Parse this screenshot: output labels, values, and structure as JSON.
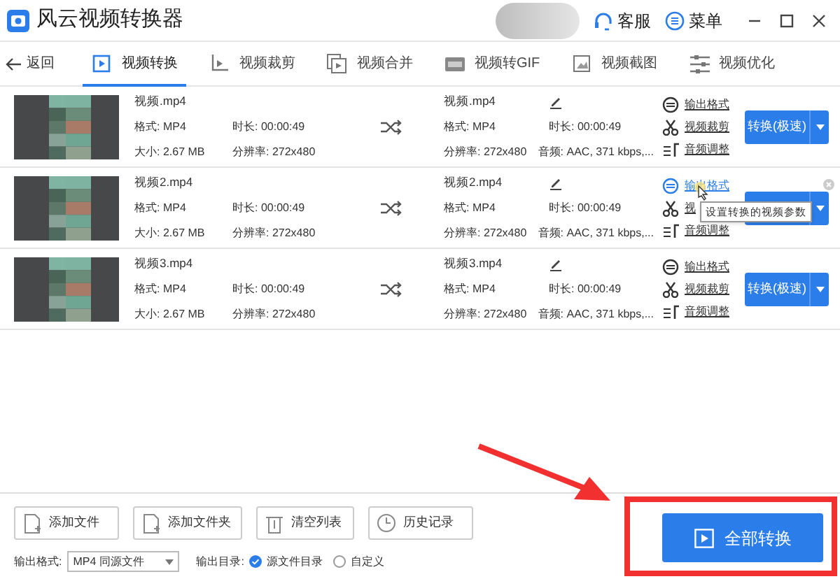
{
  "window": {
    "title": "风云视频转换器",
    "actions": [
      {
        "label": "客服",
        "kind": "support"
      },
      {
        "label": "菜单",
        "kind": "menu"
      }
    ]
  },
  "back": "返回",
  "tabs": [
    {
      "label": "视频转换",
      "kind": "convert",
      "selected": true
    },
    {
      "label": "视频裁剪",
      "kind": "crop",
      "selected": false
    },
    {
      "label": "视频合并",
      "kind": "merge",
      "selected": false
    },
    {
      "label": "视频转GIF",
      "kind": "gif",
      "selected": false
    },
    {
      "label": "视频截图",
      "kind": "shot",
      "selected": false
    },
    {
      "label": "视频优化",
      "kind": "tune",
      "selected": false
    }
  ],
  "files": [
    {
      "name": "视频.mp4",
      "format": "格式: MP4",
      "duration": "时长: 00:00:49",
      "size": "大小: 2.67 MB",
      "resolution": "分辨率: 272x480",
      "out_name": "视频.mp4",
      "out_format": "格式: MP4",
      "out_duration": "时长: 00:00:49",
      "out_resolution": "分辨率: 272x480",
      "audio": "音频: AAC, 371 kbps,...",
      "links": [
        {
          "label": "输出格式",
          "kind": "format",
          "hovered": false
        },
        {
          "label": "视频裁剪",
          "kind": "cut",
          "hovered": false
        },
        {
          "label": "音频调整",
          "kind": "audio",
          "hovered": false
        }
      ],
      "convert": "转换(极速)"
    },
    {
      "name": "视频2.mp4",
      "format": "格式: MP4",
      "duration": "时长: 00:00:49",
      "size": "大小: 2.67 MB",
      "resolution": "分辨率: 272x480",
      "out_name": "视频2.mp4",
      "out_format": "格式: MP4",
      "out_duration": "时长: 00:00:49",
      "out_resolution": "分辨率: 272x480",
      "audio": "音频: AAC, 371 kbps,...",
      "links": [
        {
          "label": "输出格式",
          "kind": "format",
          "hovered": true
        },
        {
          "label": "视",
          "kind": "cut",
          "hovered": false
        },
        {
          "label": "音频调整",
          "kind": "audio",
          "hovered": false
        }
      ],
      "tooltip": "设置转换的视频参数"
    },
    {
      "name": "视频3.mp4",
      "format": "格式: MP4",
      "duration": "时长: 00:00:49",
      "size": "大小: 2.67 MB",
      "resolution": "分辨率: 272x480",
      "out_name": "视频3.mp4",
      "out_format": "格式: MP4",
      "out_duration": "时长: 00:00:49",
      "out_resolution": "分辨率: 272x480",
      "audio": "音频: AAC, 371 kbps,...",
      "links": [
        {
          "label": "输出格式",
          "kind": "format",
          "hovered": false
        },
        {
          "label": "视频裁剪",
          "kind": "cut",
          "hovered": false
        },
        {
          "label": "音频调整",
          "kind": "audio",
          "hovered": false
        }
      ],
      "convert": "转换(极速)"
    }
  ],
  "toolbar": [
    {
      "label": "添加文件",
      "kind": "file"
    },
    {
      "label": "添加文件夹",
      "kind": "folder"
    },
    {
      "label": "清空列表",
      "kind": "trash"
    },
    {
      "label": "历史记录",
      "kind": "clock"
    }
  ],
  "output_format": {
    "label": "输出格式:",
    "value": "MP4 同源文件"
  },
  "output_dir": {
    "label": "输出目录:",
    "options": [
      {
        "label": "源文件目录",
        "selected": true
      },
      {
        "label": "自定义",
        "selected": false
      }
    ]
  },
  "convert_all": "全部转换"
}
